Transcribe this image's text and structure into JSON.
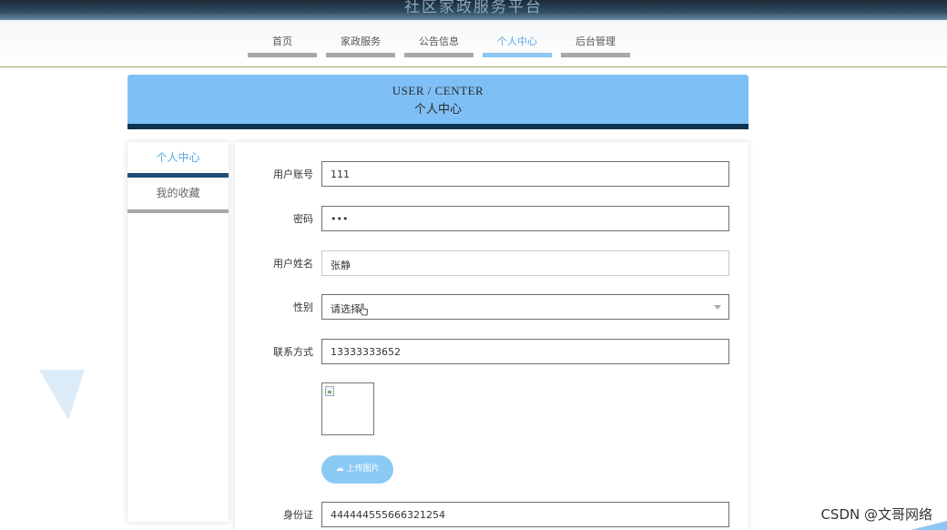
{
  "site": {
    "title": "社区家政服务平台"
  },
  "nav": {
    "items": [
      {
        "label": "首页",
        "active": false
      },
      {
        "label": "家政服务",
        "active": false
      },
      {
        "label": "公告信息",
        "active": false
      },
      {
        "label": "个人中心",
        "active": true
      },
      {
        "label": "后台管理",
        "active": false
      }
    ]
  },
  "header": {
    "title_en": "USER / CENTER",
    "title_cn": "个人中心"
  },
  "side_menu": {
    "items": [
      {
        "label": "个人中心",
        "active": true
      },
      {
        "label": "我的收藏",
        "active": false
      }
    ]
  },
  "form": {
    "account_label": "用户账号",
    "account_value": "111",
    "password_label": "密码",
    "password_value": "•••",
    "name_label": "用户姓名",
    "name_value": "张静",
    "gender_label": "性别",
    "gender_placeholder": "请选择",
    "phone_label": "联系方式",
    "phone_value": "13333333652",
    "upload_label": "上传图片",
    "id_label": "身份证",
    "id_value": "444444555666321254"
  },
  "watermark": "CSDN @文哥网络",
  "colors": {
    "accent": "#7ec0f6",
    "dark_accent": "#0e3350",
    "nav_bar": "#a8a8a8"
  }
}
